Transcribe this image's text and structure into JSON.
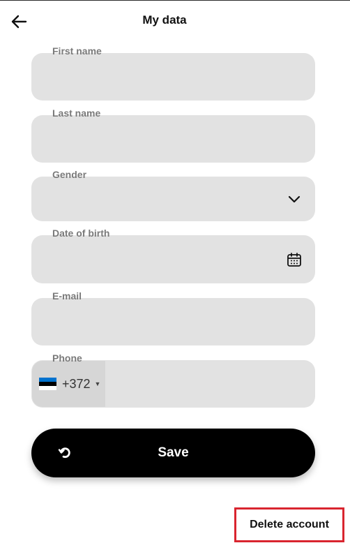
{
  "header": {
    "title": "My data",
    "back_icon": "arrow-left-icon"
  },
  "form": {
    "first_name": {
      "label": "First name",
      "value": ""
    },
    "last_name": {
      "label": "Last name",
      "value": ""
    },
    "gender": {
      "label": "Gender",
      "value": "",
      "icon": "chevron-down-icon"
    },
    "date_of_birth": {
      "label": "Date of birth",
      "value": "",
      "icon": "calendar-icon"
    },
    "email": {
      "label": "E-mail",
      "value": ""
    },
    "phone": {
      "label": "Phone",
      "country_flag": "estonia-flag-icon",
      "dial_code": "+372",
      "value": ""
    }
  },
  "actions": {
    "save_label": "Save",
    "save_icon": "refresh-icon",
    "delete_label": "Delete account"
  },
  "colors": {
    "field_bg": "#e2e2e2",
    "label": "#7a7a7a",
    "save_bg": "#000000",
    "highlight": "#d9252f",
    "flag_blue": "#0072ce",
    "flag_black": "#000000",
    "flag_white": "#ffffff"
  }
}
